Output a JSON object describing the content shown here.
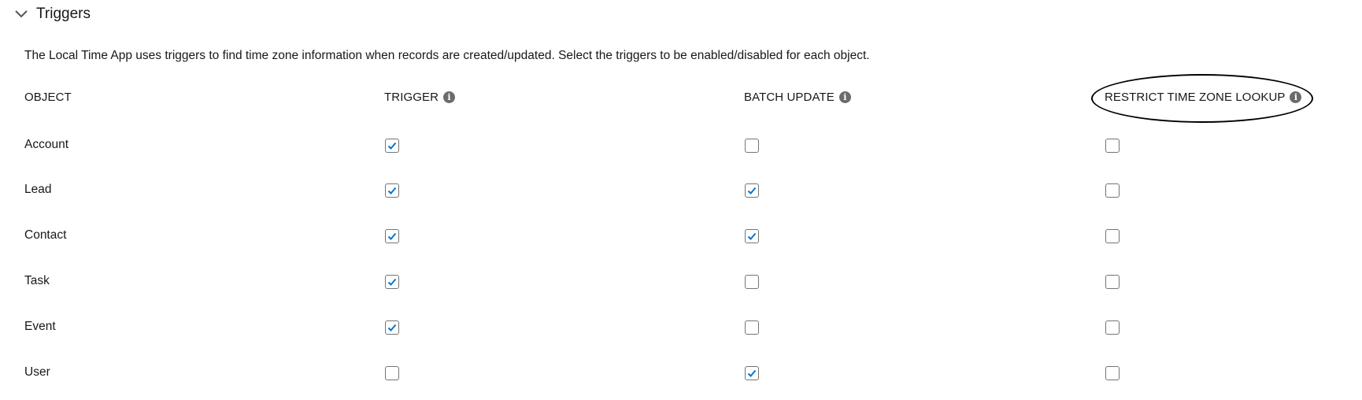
{
  "section": {
    "title": "Triggers",
    "description": "The Local Time App uses triggers to find time zone information when records are created/updated. Select the triggers to be enabled/disabled for each object."
  },
  "columns": {
    "object": "OBJECT",
    "trigger": "TRIGGER",
    "batch_update": "BATCH UPDATE",
    "restrict": "RESTRICT TIME ZONE LOOKUP"
  },
  "rows": [
    {
      "label": "Account",
      "trigger": true,
      "batch_update": false,
      "restrict": false
    },
    {
      "label": "Lead",
      "trigger": true,
      "batch_update": true,
      "restrict": false
    },
    {
      "label": "Contact",
      "trigger": true,
      "batch_update": true,
      "restrict": false
    },
    {
      "label": "Task",
      "trigger": true,
      "batch_update": false,
      "restrict": false
    },
    {
      "label": "Event",
      "trigger": true,
      "batch_update": false,
      "restrict": false
    },
    {
      "label": "User",
      "trigger": false,
      "batch_update": true,
      "restrict": false
    }
  ],
  "icons": {
    "collapse": "chevron-down-icon",
    "info": "info-icon",
    "check": "checkmark-icon"
  },
  "colors": {
    "check": "#0176d3",
    "info_icon": "#6b6b6b",
    "checkbox_border": "#747474"
  }
}
